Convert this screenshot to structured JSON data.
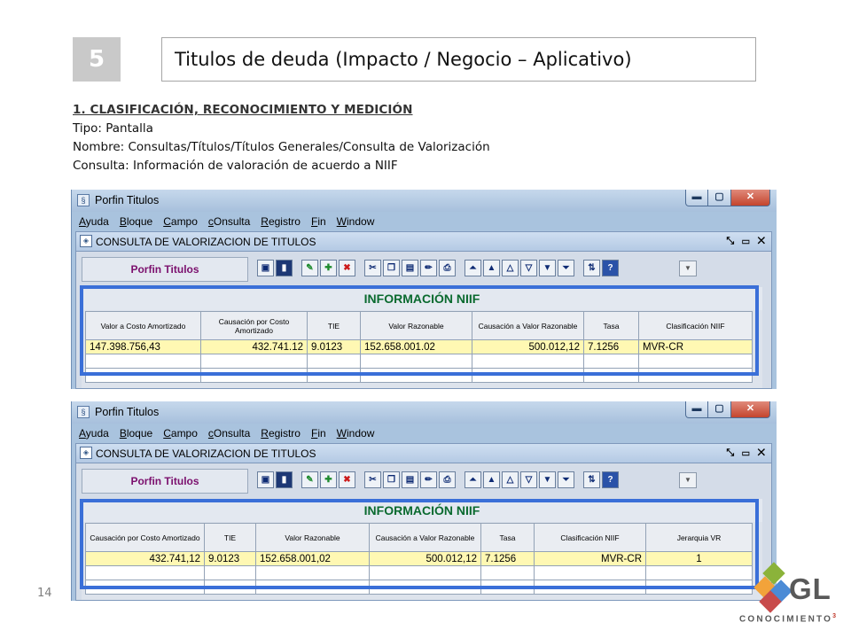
{
  "slide": {
    "number": "5",
    "title": "Titulos de deuda (Impacto / Negocio – Aplicativo)",
    "heading": "1. CLASIFICACIÓN, RECONOCIMIENTO Y MEDICIÓN",
    "lines": [
      "Tipo: Pantalla",
      "Nombre: Consultas/Títulos/Títulos Generales/Consulta de Valorización",
      "Consulta: Información de valoración de acuerdo a NIIF"
    ],
    "page_number": "14"
  },
  "logo": {
    "text": "GL",
    "subtitle": "CONOCIMIENTO",
    "superscript": "3"
  },
  "app": {
    "window_title": "Porfin Titulos",
    "window_buttons": {
      "minimize": "▬",
      "maximize": "▢",
      "close": "✕"
    },
    "menu": [
      "Ayuda",
      "Bloque",
      "Campo",
      "cOnsulta",
      "Registro",
      "Fin",
      "Window"
    ],
    "form_title": "CONSULTA DE VALORIZACION DE TITULOS",
    "form_controls": "⤡ ▭ ✕",
    "label": "Porfin Titulos",
    "section_title": "INFORMACIÓN NIIF"
  },
  "screen1": {
    "columns": [
      "Valor a Costo Amortizado",
      "Causación por Costo Amortizado",
      "TIE",
      "Valor Razonable",
      "Causación a Valor Razonable",
      "Tasa",
      "Clasificación NIIF"
    ],
    "row": [
      "147.398.756,43",
      "432.741.12",
      "9.0123",
      "152.658.001.02",
      "500.012,12",
      "7.1256",
      "MVR-CR"
    ]
  },
  "screen2": {
    "columns": [
      "Causación por Costo Amortizado",
      "TIE",
      "Valor Razonable",
      "Causación a Valor Razonable",
      "Tasa",
      "Clasificación NIIF",
      "Jerarquia VR"
    ],
    "row": [
      "432.741,12",
      "9.0123",
      "152.658.001,02",
      "500.012,12",
      "7.1256",
      "MVR-CR",
      "1"
    ]
  },
  "colors": {
    "frame": "#3a6fd8",
    "section_green": "#0a6a2f",
    "label_purple": "#7b0f6d",
    "row_highlight": "#fff8b3"
  }
}
